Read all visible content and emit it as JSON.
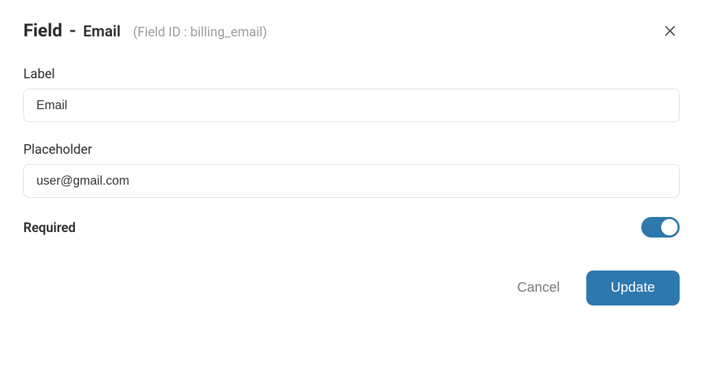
{
  "header": {
    "title_prefix": "Field",
    "title_sep": "-",
    "title_secondary": "Email",
    "field_id_text": "(Field ID : billing_email)"
  },
  "form": {
    "label": {
      "label_text": "Label",
      "value": "Email"
    },
    "placeholder": {
      "label_text": "Placeholder",
      "value": "user@gmail.com"
    },
    "required": {
      "label_text": "Required",
      "value": true
    }
  },
  "footer": {
    "cancel_label": "Cancel",
    "update_label": "Update"
  },
  "colors": {
    "primary": "#2d78ad"
  }
}
